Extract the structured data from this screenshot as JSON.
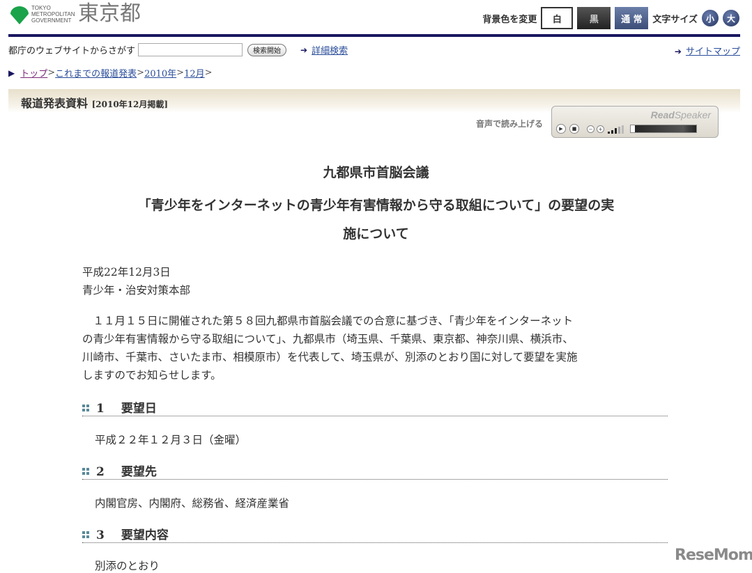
{
  "header": {
    "logo_en": [
      "TOKYO",
      "METROPOLITAN",
      "GOVERNMENT"
    ],
    "logo_jp": "東京都",
    "bg_label": "背景色を変更",
    "bg_white": "白",
    "bg_black": "黒",
    "bg_normal": "通 常",
    "font_label": "文字サイズ",
    "font_small": "小",
    "font_large": "大"
  },
  "search": {
    "label": "都庁のウェブサイトからさがす",
    "value": "",
    "button": "検索開始",
    "advanced": "詳細検索",
    "sitemap": "サイトマップ"
  },
  "breadcrumb": {
    "items": [
      "トップ",
      "これまでの報道発表",
      "2010年",
      "12月"
    ],
    "sep": ">"
  },
  "banner": {
    "title": "報道発表資料",
    "date": "[2010年12月掲載]"
  },
  "readspeaker": {
    "label": "音声で読み上げる",
    "brand_bold": "Read",
    "brand": "Speaker"
  },
  "article": {
    "title": [
      "九都県市首脳会議",
      "「青少年をインターネットの青少年有害情報から守る取組について」の要望の実",
      "施について"
    ],
    "date": "平成22年12月3日",
    "dept": "青少年・治安対策本部",
    "body": [
      "　１１月１５日に開催された第５８回九都県市首脳会議での合意に基づき、「青少年をインターネット",
      "の青少年有害情報から守る取組について」、九都県市（埼玉県、千葉県、東京都、神奈川県、横浜市、",
      "川崎市、千葉市、さいたま市、相模原市）を代表して、埼玉県が、別添のとおり国に対して要望を実施",
      "しますのでお知らせします。"
    ],
    "sections": [
      {
        "num": "1",
        "title": "要望日",
        "content": "平成２２年１２月３日（金曜）"
      },
      {
        "num": "2",
        "title": "要望先",
        "content": "内閣官房、内閣府、総務省、経済産業省"
      },
      {
        "num": "3",
        "title": "要望内容",
        "content": "別添のとおり"
      }
    ]
  },
  "watermark": "ReseMom"
}
